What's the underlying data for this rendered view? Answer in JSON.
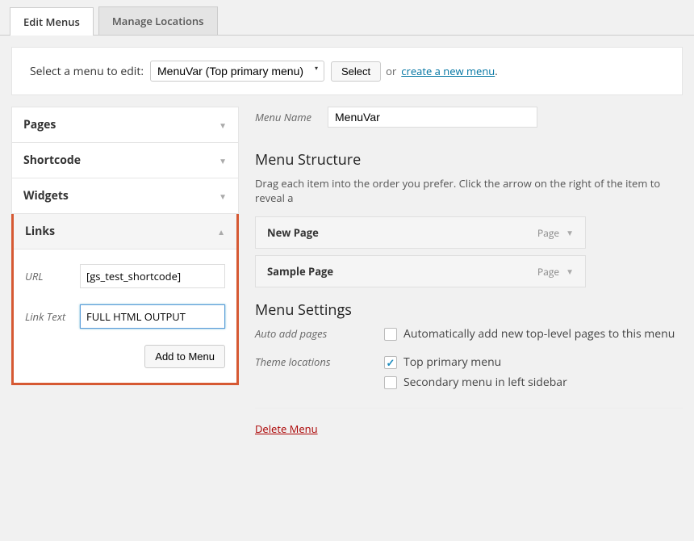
{
  "tabs": {
    "edit_menus": "Edit Menus",
    "manage_locations": "Manage Locations"
  },
  "select_row": {
    "label": "Select a menu to edit:",
    "selected": "MenuVar (Top primary menu)",
    "select_btn": "Select",
    "or": "or",
    "create_link": "create a new menu",
    "period": "."
  },
  "panels": {
    "pages": "Pages",
    "shortcode": "Shortcode",
    "widgets": "Widgets",
    "links": "Links"
  },
  "links_form": {
    "url_label": "URL",
    "url_value": "[gs_test_shortcode]",
    "linktext_label": "Link Text",
    "linktext_value": "FULL HTML OUTPUT",
    "add_btn": "Add to Menu"
  },
  "menu_name": {
    "label": "Menu Name",
    "value": "MenuVar"
  },
  "structure": {
    "heading": "Menu Structure",
    "desc": "Drag each item into the order you prefer. Click the arrow on the right of the item to reveal a",
    "items": [
      {
        "name": "New Page",
        "type": "Page"
      },
      {
        "name": "Sample Page",
        "type": "Page"
      }
    ]
  },
  "settings": {
    "heading": "Menu Settings",
    "auto_add_label": "Auto add pages",
    "auto_add_opt": "Automatically add new top-level pages to this menu",
    "theme_loc_label": "Theme locations",
    "theme_opts": [
      {
        "label": "Top primary menu",
        "checked": true
      },
      {
        "label": "Secondary menu in left sidebar",
        "checked": false
      }
    ]
  },
  "delete_label": "Delete Menu"
}
